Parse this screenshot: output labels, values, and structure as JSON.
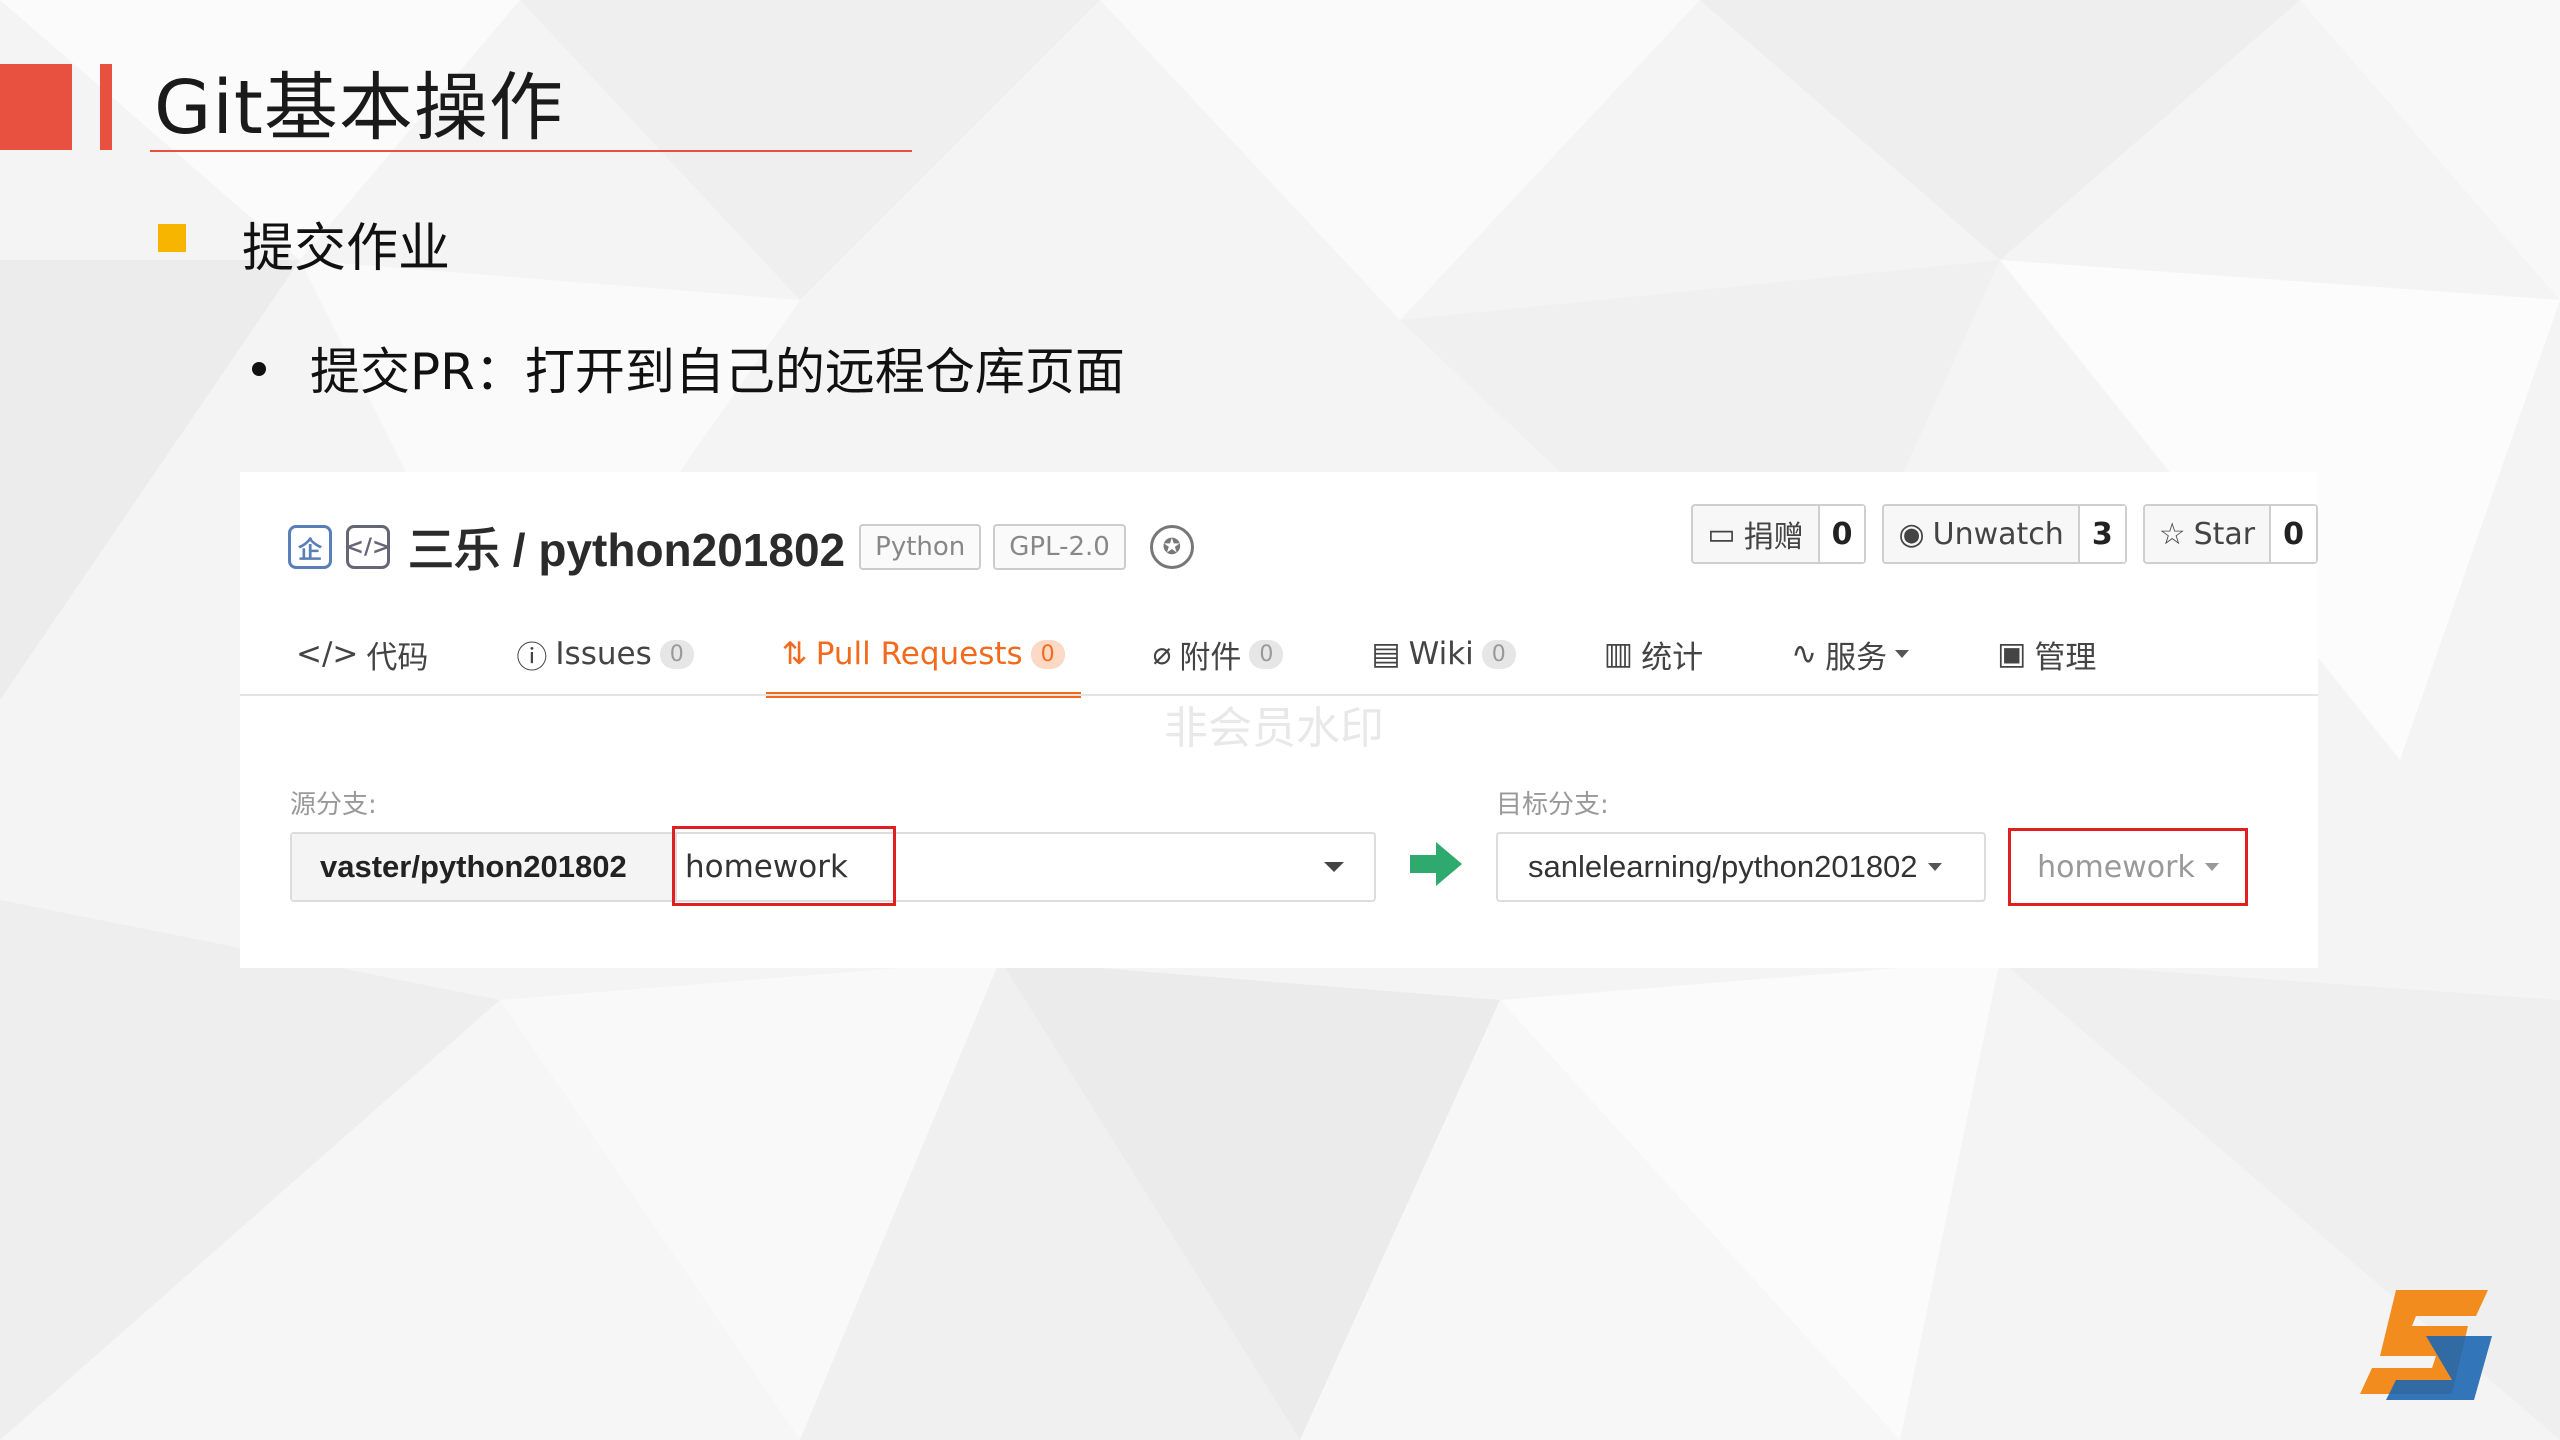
{
  "slide": {
    "title": "Git基本操作",
    "bullet": "提交作业",
    "sub_bullet": "提交PR：打开到自己的远程仓库页面"
  },
  "repo": {
    "owner_repo": "三乐 / python201802",
    "tags": [
      "Python",
      "GPL-2.0"
    ],
    "actions": [
      {
        "label": "捐赠",
        "count": "0",
        "icon": "donate-icon"
      },
      {
        "label": "Unwatch",
        "count": "3",
        "icon": "eye-icon"
      },
      {
        "label": "Star",
        "count": "0",
        "icon": "star-icon"
      }
    ]
  },
  "tabs": [
    {
      "label": "代码",
      "icon": "code-icon"
    },
    {
      "label": "Issues",
      "count": "0",
      "icon": "issue-icon"
    },
    {
      "label": "Pull Requests",
      "count": "0",
      "icon": "pull-request-icon",
      "active": true
    },
    {
      "label": "附件",
      "count": "0",
      "icon": "attachment-icon"
    },
    {
      "label": "Wiki",
      "count": "0",
      "icon": "book-icon"
    },
    {
      "label": "统计",
      "icon": "chart-icon"
    },
    {
      "label": "服务",
      "icon": "pulse-icon"
    },
    {
      "label": "管理",
      "icon": "settings-doc-icon"
    }
  ],
  "watermark": "非会员水印",
  "pr_form": {
    "source_label": "源分支:",
    "source_repo": "vaster/python201802",
    "source_branch": "homework",
    "target_label": "目标分支:",
    "target_repo": "sanlelearning/python201802",
    "target_branch": "homework"
  },
  "colors": {
    "accent_red": "#e8503f",
    "bullet_yellow": "#f7b500",
    "active_tab": "#f26b1d",
    "highlight_box": "#e02020",
    "arrow_green": "#2eaa6e"
  }
}
